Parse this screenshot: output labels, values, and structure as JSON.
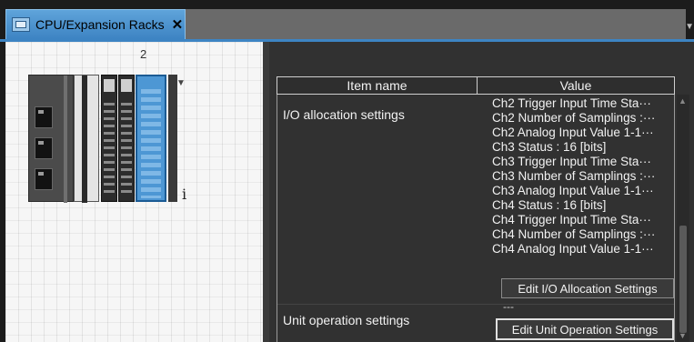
{
  "tab": {
    "title": "CPU/Expansion Racks",
    "close_glyph": "✕",
    "icon": "rack-icon"
  },
  "rack": {
    "slot_number": "2",
    "info_glyph": "i",
    "selected_unit": "slot-2-io-unit"
  },
  "grid": {
    "headers": {
      "item_name": "Item name",
      "value": "Value"
    },
    "rows": [
      {
        "label": "I/O allocation settings",
        "values": [
          "Ch2 Trigger Input Time Sta···",
          "Ch2 Number of Samplings :···",
          "Ch2 Analog Input Value 1-1···",
          "Ch3 Status : 16 [bits]",
          "Ch3 Trigger Input Time Sta···",
          "Ch3 Number of Samplings :···",
          "Ch3 Analog Input Value 1-1···",
          "Ch4 Status : 16 [bits]",
          "Ch4 Trigger Input Time Sta···",
          "Ch4 Number of Samplings :···",
          "Ch4 Analog Input Value 1-1···"
        ],
        "button": "Edit I/O Allocation Settings"
      },
      {
        "label": "Unit operation settings",
        "dash": "---",
        "button": "Edit Unit Operation Settings"
      }
    ]
  },
  "colors": {
    "accent": "#3d84c3",
    "panel_dark": "#313131",
    "selected_unit": "#4d97d4"
  }
}
